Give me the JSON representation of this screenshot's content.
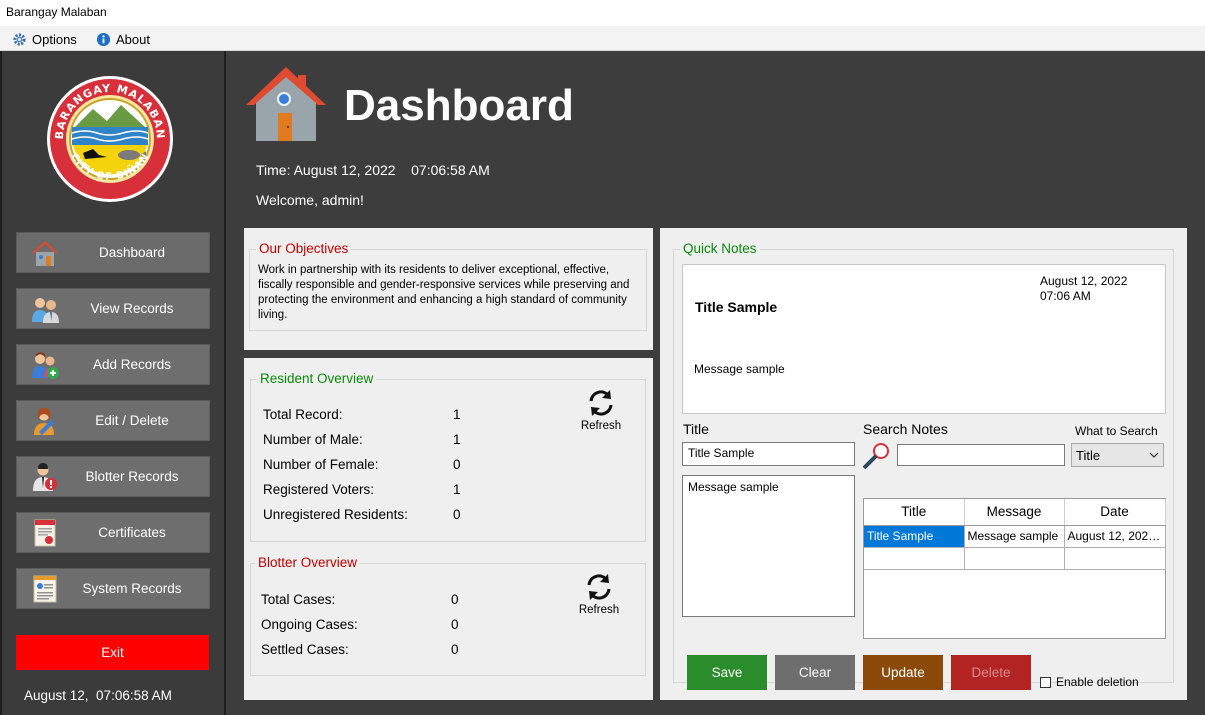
{
  "window": {
    "title": "Barangay Malaban"
  },
  "menu": {
    "options": "Options",
    "about": "About"
  },
  "logo": {
    "top_text": "BARANGAY MALABAN",
    "bottom_text": "CITY OF BIÑAN"
  },
  "sidebar": {
    "items": [
      {
        "label": "Dashboard",
        "icon": "house-icon"
      },
      {
        "label": "View Records",
        "icon": "people-icon"
      },
      {
        "label": "Add Records",
        "icon": "add-user-icon"
      },
      {
        "label": "Edit / Delete",
        "icon": "edit-user-icon"
      },
      {
        "label": "Blotter Records",
        "icon": "alert-user-icon"
      },
      {
        "label": "Certificates",
        "icon": "certificate-icon"
      },
      {
        "label": "System Records",
        "icon": "document-icon"
      }
    ],
    "exit": "Exit",
    "clock": "August 12,  07:06:58 AM"
  },
  "header": {
    "title": "Dashboard",
    "time": "Time: August 12, 2022    07:06:58 AM",
    "welcome": "Welcome, admin!"
  },
  "objectives": {
    "title": "Our Objectives",
    "text": "Work in partnership with its residents to deliver exceptional, effective, fiscally responsible and gender-responsive services while preserving and protecting the environment and enhancing a high standard of community living."
  },
  "resident_overview": {
    "title": "Resident Overview",
    "refresh": "Refresh",
    "rows": [
      {
        "label": "Total Record:",
        "value": "1"
      },
      {
        "label": "Number of Male:",
        "value": "1"
      },
      {
        "label": "Number of Female:",
        "value": "0"
      },
      {
        "label": "Registered Voters:",
        "value": "1"
      },
      {
        "label": "Unregistered Residents:",
        "value": "0"
      }
    ]
  },
  "blotter_overview": {
    "title": "Blotter Overview",
    "refresh": "Refresh",
    "rows": [
      {
        "label": "Total Cases:",
        "value": "0"
      },
      {
        "label": "Ongoing Cases:",
        "value": "0"
      },
      {
        "label": "Settled Cases:",
        "value": "0"
      }
    ]
  },
  "quick_notes": {
    "title": "Quick Notes",
    "preview": {
      "date": "August 12, 2022\n07:06 AM",
      "title": "Title Sample",
      "message": "Message sample"
    },
    "title_label": "Title",
    "title_value": "Title Sample",
    "message_value": "Message sample",
    "search_label": "Search Notes",
    "search_value": "",
    "what_to_search_label": "What to Search",
    "what_to_search_value": "Title",
    "table": {
      "columns": [
        "Title",
        "Message",
        "Date"
      ],
      "rows": [
        [
          "Title Sample",
          "Message sample",
          "August 12, 202…"
        ]
      ]
    },
    "buttons": {
      "save": "Save",
      "clear": "Clear",
      "update": "Update",
      "delete": "Delete"
    },
    "enable_deletion": "Enable deletion"
  },
  "colors": {
    "save": "#2a8c2a",
    "clear": "#6e6e6e",
    "update": "#8b4a0a",
    "delete": "#b22424",
    "exit": "#ff0000",
    "selection": "#0078d7"
  }
}
